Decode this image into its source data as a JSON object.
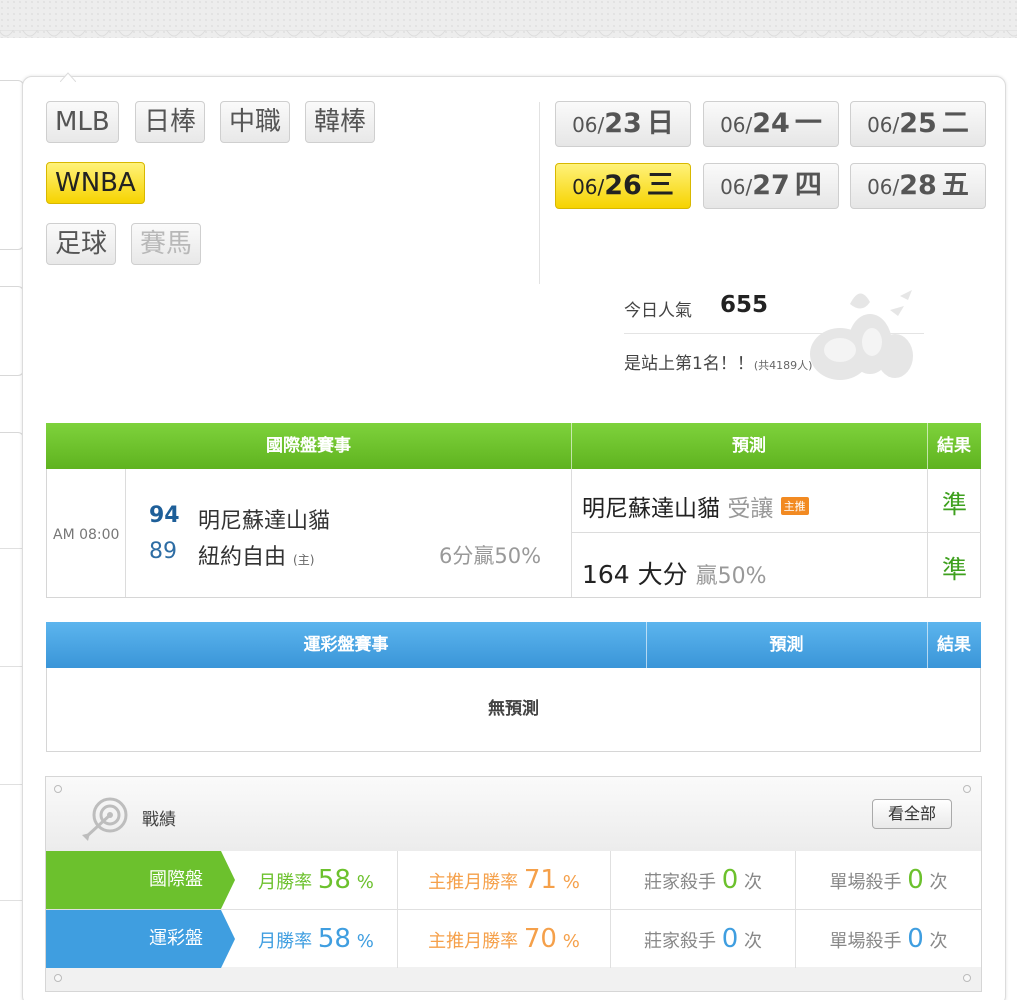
{
  "leagues": [
    {
      "label": "MLB",
      "state": "normal"
    },
    {
      "label": "日棒",
      "state": "normal"
    },
    {
      "label": "中職",
      "state": "normal"
    },
    {
      "label": "韓棒",
      "state": "normal"
    },
    {
      "label": "WNBA",
      "state": "active"
    },
    {
      "label": "足球",
      "state": "normal"
    },
    {
      "label": "賽馬",
      "state": "disabled"
    }
  ],
  "dates": [
    {
      "md": "06/",
      "day": "23",
      "weekday": "日",
      "active": false
    },
    {
      "md": "06/",
      "day": "24",
      "weekday": "一",
      "active": false
    },
    {
      "md": "06/",
      "day": "25",
      "weekday": "二",
      "active": false
    },
    {
      "md": "06/",
      "day": "26",
      "weekday": "三",
      "active": true
    },
    {
      "md": "06/",
      "day": "27",
      "weekday": "四",
      "active": false
    },
    {
      "md": "06/",
      "day": "28",
      "weekday": "五",
      "active": false
    }
  ],
  "popularity": {
    "label": "今日人氣",
    "count": "655",
    "rank_text": "是站上第1名！！",
    "total_text": "(共4189人)"
  },
  "intl_table": {
    "headers": {
      "event": "國際盤賽事",
      "prediction": "預測",
      "result": "結果"
    },
    "game": {
      "time": "AM 08:00",
      "away": {
        "score": "94",
        "name": "明尼蘇達山貓"
      },
      "home": {
        "score": "89",
        "name": "紐約自由",
        "tag": "(主)"
      },
      "note": "6分贏50%",
      "predictions": [
        {
          "pick": "明尼蘇達山貓",
          "detail": "受讓",
          "badge": "主推",
          "result": "準"
        },
        {
          "pick": "164 大分",
          "detail": "贏50%",
          "result": "準"
        }
      ]
    }
  },
  "sports_table": {
    "headers": {
      "event": "運彩盤賽事",
      "prediction": "預測",
      "result": "結果"
    },
    "empty_text": "無預測"
  },
  "record": {
    "title": "戰績",
    "see_all": "看全部",
    "rows": [
      {
        "label": "國際盤",
        "color": "#6cc12d",
        "month_label": "月勝率",
        "month_value": "58",
        "month_unit": "%",
        "month_color": "#6cc12d",
        "main_label": "主推月勝率",
        "main_value": "71",
        "main_unit": "%",
        "main_color": "#f5a04a",
        "dealer_label": "莊家殺手",
        "dealer_value": "0",
        "dealer_unit": "次",
        "dealer_color": "#6cc12d",
        "single_label": "單場殺手",
        "single_value": "0",
        "single_unit": "次",
        "single_color": "#6cc12d"
      },
      {
        "label": "運彩盤",
        "color": "#3f9ee0",
        "month_label": "月勝率",
        "month_value": "58",
        "month_unit": "%",
        "month_color": "#3f9ee0",
        "main_label": "主推月勝率",
        "main_value": "70",
        "main_unit": "%",
        "main_color": "#f5a04a",
        "dealer_label": "莊家殺手",
        "dealer_value": "0",
        "dealer_unit": "次",
        "dealer_color": "#3f9ee0",
        "single_label": "單場殺手",
        "single_value": "0",
        "single_unit": "次",
        "single_color": "#3f9ee0"
      }
    ]
  },
  "colors": {
    "green_header": "#6cc12d",
    "blue_header": "#3f9ee0",
    "active_yellow": "#f6d300",
    "result_green": "#3ea01e"
  }
}
